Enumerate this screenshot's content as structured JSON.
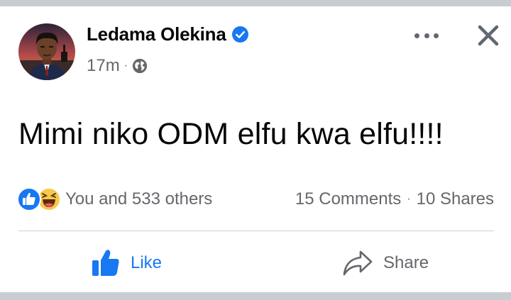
{
  "post": {
    "author": "Ledama Olekina",
    "time": "17m",
    "meta_separator": "·",
    "privacy_icon": "globe-icon",
    "text": "Mimi niko ODM elfu kwa elfu!!!!"
  },
  "reactions": {
    "icons": [
      "like-reaction-icon",
      "haha-reaction-icon"
    ],
    "summary": "You and 533 others"
  },
  "counts": {
    "comments": "15 Comments",
    "separator": "·",
    "shares": "10 Shares"
  },
  "actions": {
    "like_label": "Like",
    "share_label": "Share"
  },
  "colors": {
    "accent": "#1877f2",
    "text_primary": "#050505",
    "text_secondary": "#65676b",
    "divider": "#ced0d4",
    "frame": "#c9ccd1",
    "haha_yellow": "#f7c84b"
  }
}
